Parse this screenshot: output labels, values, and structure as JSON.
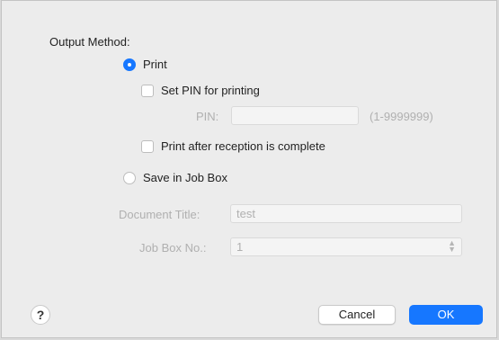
{
  "output_method": {
    "label": "Output Method:",
    "print": {
      "label": "Print",
      "selected": true
    },
    "set_pin": {
      "label": "Set PIN for printing",
      "checked": false
    },
    "pin": {
      "label": "PIN:",
      "value": "",
      "range_hint": "(1-9999999)"
    },
    "print_after_reception": {
      "label": "Print after reception is complete",
      "checked": false
    },
    "save_in_job_box": {
      "label": "Save in Job Box",
      "selected": false
    },
    "document_title": {
      "label": "Document Title:",
      "value": "test"
    },
    "job_box_no": {
      "label": "Job Box No.:",
      "value": "1"
    }
  },
  "buttons": {
    "help": "?",
    "cancel": "Cancel",
    "ok": "OK"
  },
  "colors": {
    "accent": "#1677ff",
    "background": "#ececec",
    "disabled_text": "#b0b0b0"
  }
}
